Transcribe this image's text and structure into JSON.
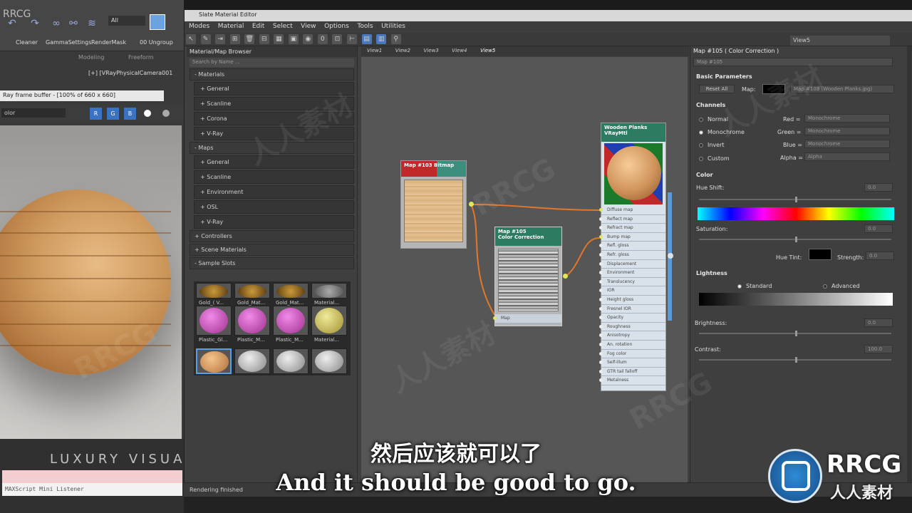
{
  "max": {
    "watermark_top": "RRCG",
    "filter": "All",
    "ribbon_labels": [
      "Cleaner",
      "GammaSettings",
      "RenderMask",
      "00 Ungroup"
    ],
    "tabs": [
      "Modeling",
      "Freeform"
    ],
    "viewport_label": "[+] [VRayPhysicalCamera001",
    "vfb_title": "Ray frame buffer - [100% of 660 x 660]",
    "vfb_channel": "olor",
    "vfb_rgb": [
      "R",
      "G",
      "B"
    ],
    "listener": "MAXScript Mini Listener",
    "status": "Rendering finished"
  },
  "slate": {
    "title": "Slate Material Editor",
    "menus": [
      "Modes",
      "Material",
      "Edit",
      "Select",
      "View",
      "Options",
      "Tools",
      "Utilities"
    ],
    "view_dropdown": "View5",
    "browser_title": "Material/Map Browser",
    "search_placeholder": "Search by Name ...",
    "materials_header": "- Materials",
    "materials": [
      "+ General",
      "+ Scanline",
      "+ Corona",
      "+ V-Ray"
    ],
    "maps_header": "- Maps",
    "maps": [
      "+ General",
      "+ Scanline",
      "+ Environment",
      "+ OSL",
      "+ V-Ray"
    ],
    "controllers": "+ Controllers",
    "scene_materials": "+ Scene Materials",
    "sample_slots": "- Sample Slots",
    "slot_labels": [
      "Gold_( V...",
      "Gold_Mat...",
      "Gold_Mat...",
      "Material...",
      "Plastic_Gl...",
      "Plastic_M...",
      "Plastic_M...",
      "Material..."
    ],
    "view_tabs": [
      "View1",
      "View2",
      "View3",
      "View4",
      "View5"
    ],
    "node_bitmap_title": "Map #103\nBitmap",
    "node_cc_title1": "Map #105",
    "node_cc_title2": "Color Correction",
    "node_cc_port": "Map",
    "node_mtl_title1": "Wooden Planks",
    "node_mtl_title2": "VRayMtl",
    "ports": [
      "Diffuse map",
      "Reflect map",
      "Refract map",
      "Bump map",
      "Refl. gloss",
      "Refr. gloss",
      "Displacement",
      "Environment",
      "Translucency",
      "IOR",
      "Height gloss",
      "Fresnel IOR",
      "Opacity",
      "Roughness",
      "Anisotropy",
      "An. rotation",
      "Fog color",
      "Self-illum",
      "GTR tail falloff",
      "Metalness"
    ]
  },
  "params": {
    "title": "Map #105 ( Color Correction )",
    "name_field": "Map #105",
    "basic_params": "Basic Parameters",
    "reset_all": "Reset All",
    "map_label": "Map:",
    "map_value": "Map #103 (Wooden Planks.jpg)",
    "channels": "Channels",
    "channel_options": [
      "Normal",
      "Monochrome",
      "Invert",
      "Custom"
    ],
    "rgba_labels": [
      "Red =",
      "Green =",
      "Blue =",
      "Alpha ="
    ],
    "rgba_values": [
      "Monochrome",
      "Monochrome",
      "Monochrome",
      "Alpha"
    ],
    "color": "Color",
    "hue_shift": "Hue Shift:",
    "hue_shift_value": "0.0",
    "saturation": "Saturation:",
    "saturation_value": "0.0",
    "hue_tint": "Hue Tint:",
    "strength": "Strength:",
    "strength_value": "0.0",
    "lightness": "Lightness",
    "standard": "Standard",
    "advanced": "Advanced",
    "brightness": "Brightness:",
    "brightness_value": "0.0",
    "contrast": "Contrast:",
    "contrast_value": "100.0"
  },
  "overlay": {
    "subtitle_cn": "然后应该就可以了",
    "subtitle_en": "And it should be good to go.",
    "logo_text": "RRCG",
    "logo_sub": "人人素材",
    "luxury": "LUXURY VISUALS"
  }
}
